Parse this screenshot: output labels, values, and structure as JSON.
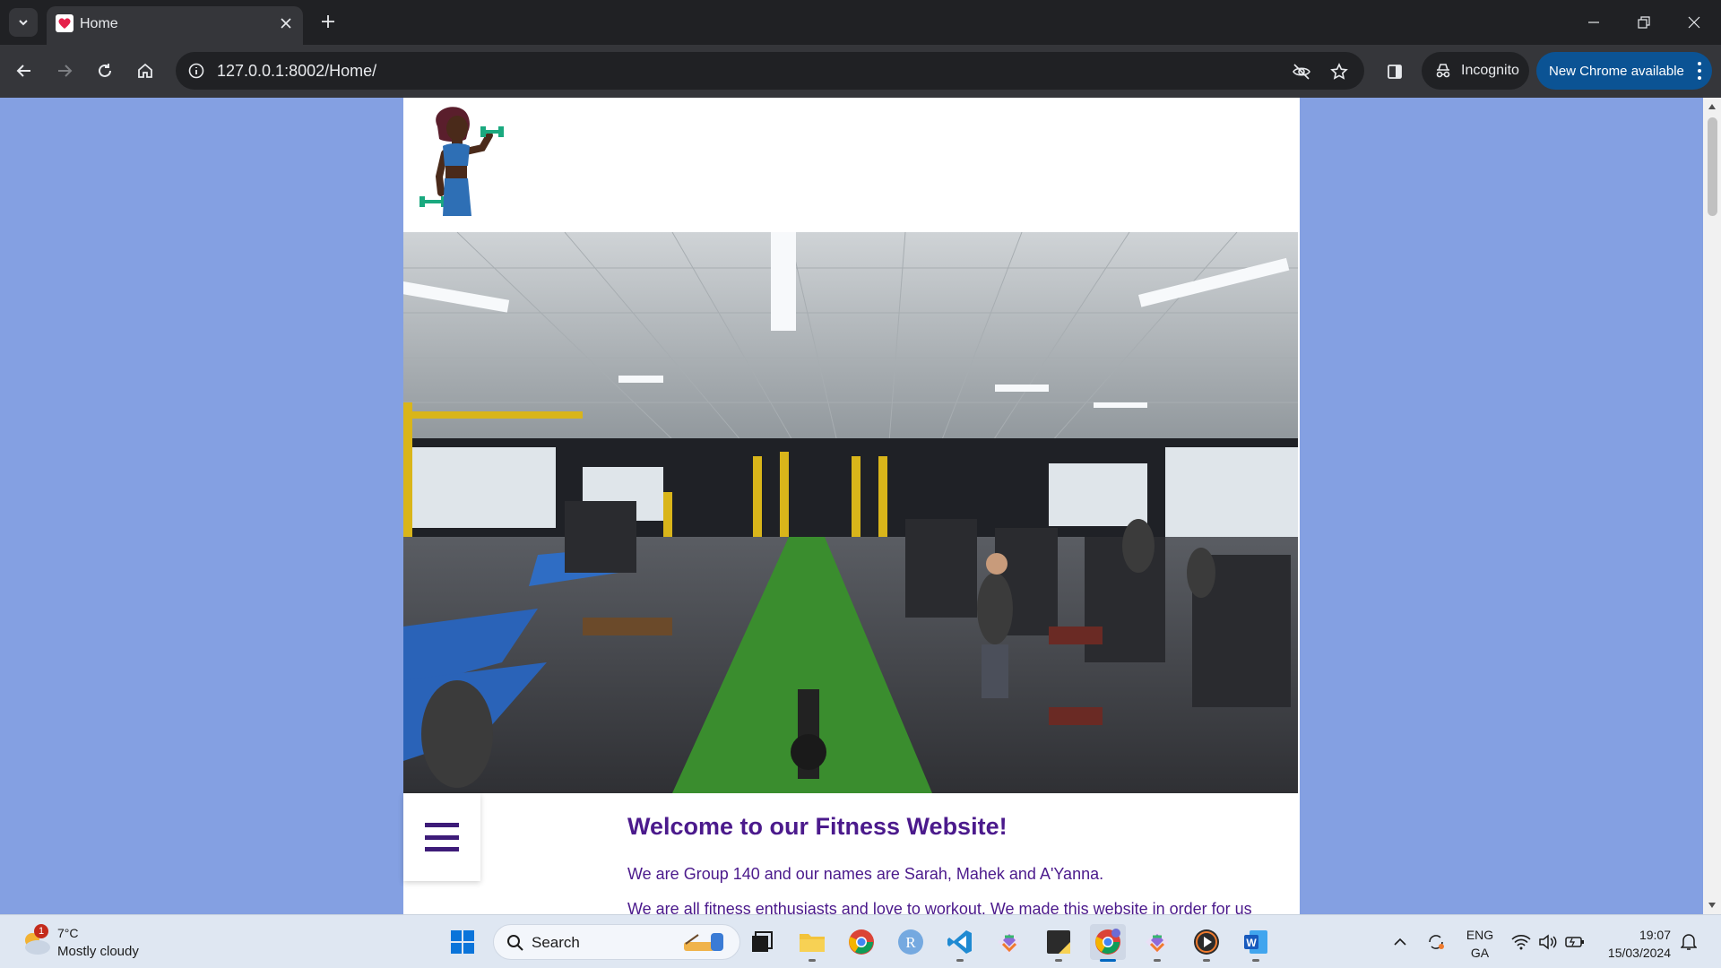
{
  "browser": {
    "tab": {
      "title": "Home",
      "favicon": "heart-icon"
    },
    "omnibox": {
      "url": "127.0.0.1:8002/Home/"
    },
    "incognito_label": "Incognito",
    "update_label": "New Chrome available"
  },
  "page": {
    "logo": "woman-lifting-dumbbells-logo",
    "hero_image": "gym-interior-photo",
    "welcome_title": "Welcome to our Fitness Website!",
    "intro_paragraph_1": "We are Group 140 and our names are Sarah, Mahek and A'Yanna.",
    "intro_paragraph_2": "We are all fitness enthusiasts and love to workout. We made this website in order for us"
  },
  "taskbar": {
    "weather": {
      "temp": "7°C",
      "description": "Mostly cloudy",
      "badge": "1"
    },
    "search_label": "Search",
    "language": {
      "line1": "ENG",
      "line2": "GA"
    },
    "clock": {
      "time": "19:07",
      "date": "15/03/2024"
    },
    "pinned_apps": [
      "windows-start",
      "search",
      "task-view-widget",
      "file-manager",
      "file-explorer",
      "chrome",
      "r-app",
      "vscode",
      "git-app",
      "sticky-notes",
      "chrome-active",
      "git-app-2",
      "media-player",
      "word"
    ]
  },
  "colors": {
    "page_background": "#84a0e2",
    "title_text": "#4b1a8c",
    "update_button": "#0b5394"
  }
}
